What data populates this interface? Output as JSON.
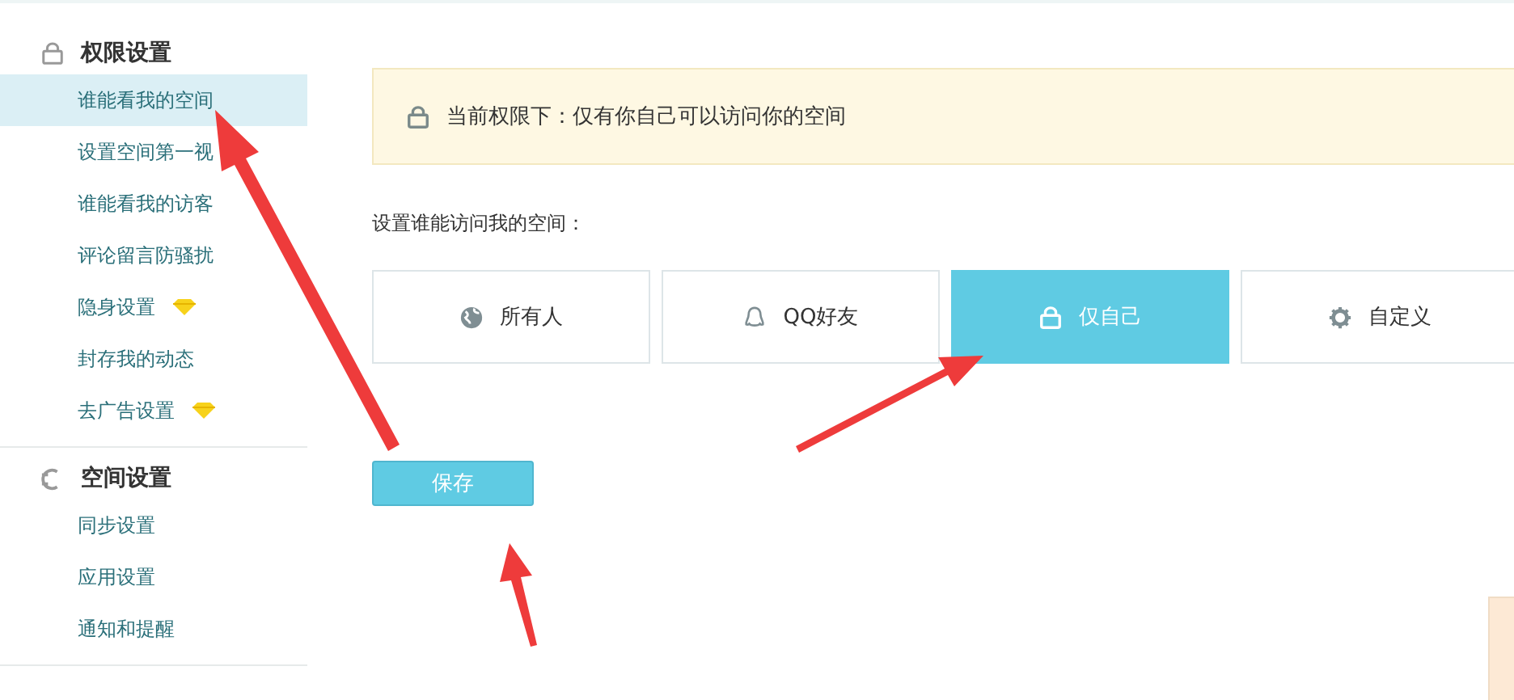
{
  "sidebar": {
    "sections": [
      {
        "title": "权限设置",
        "items": [
          {
            "label": "谁能看我的空间",
            "selected": true,
            "vip": false
          },
          {
            "label": "设置空间第一视",
            "selected": false,
            "vip": false
          },
          {
            "label": "谁能看我的访客",
            "selected": false,
            "vip": false
          },
          {
            "label": "评论留言防骚扰",
            "selected": false,
            "vip": false
          },
          {
            "label": "隐身设置",
            "selected": false,
            "vip": true
          },
          {
            "label": "封存我的动态",
            "selected": false,
            "vip": false
          },
          {
            "label": "去广告设置",
            "selected": false,
            "vip": true
          }
        ]
      },
      {
        "title": "空间设置",
        "items": [
          {
            "label": "同步设置",
            "selected": false,
            "vip": false
          },
          {
            "label": "应用设置",
            "selected": false,
            "vip": false
          },
          {
            "label": "通知和提醒",
            "selected": false,
            "vip": false
          }
        ]
      }
    ]
  },
  "notice": {
    "text": "当前权限下：仅有你自己可以访问你的空间"
  },
  "access": {
    "label": "设置谁能访问我的空间：",
    "options": [
      {
        "label": "所有人",
        "selected": false
      },
      {
        "label": "QQ好友",
        "selected": false
      },
      {
        "label": "仅自己",
        "selected": true
      },
      {
        "label": "自定义",
        "selected": false
      }
    ]
  },
  "save_button": "保存"
}
